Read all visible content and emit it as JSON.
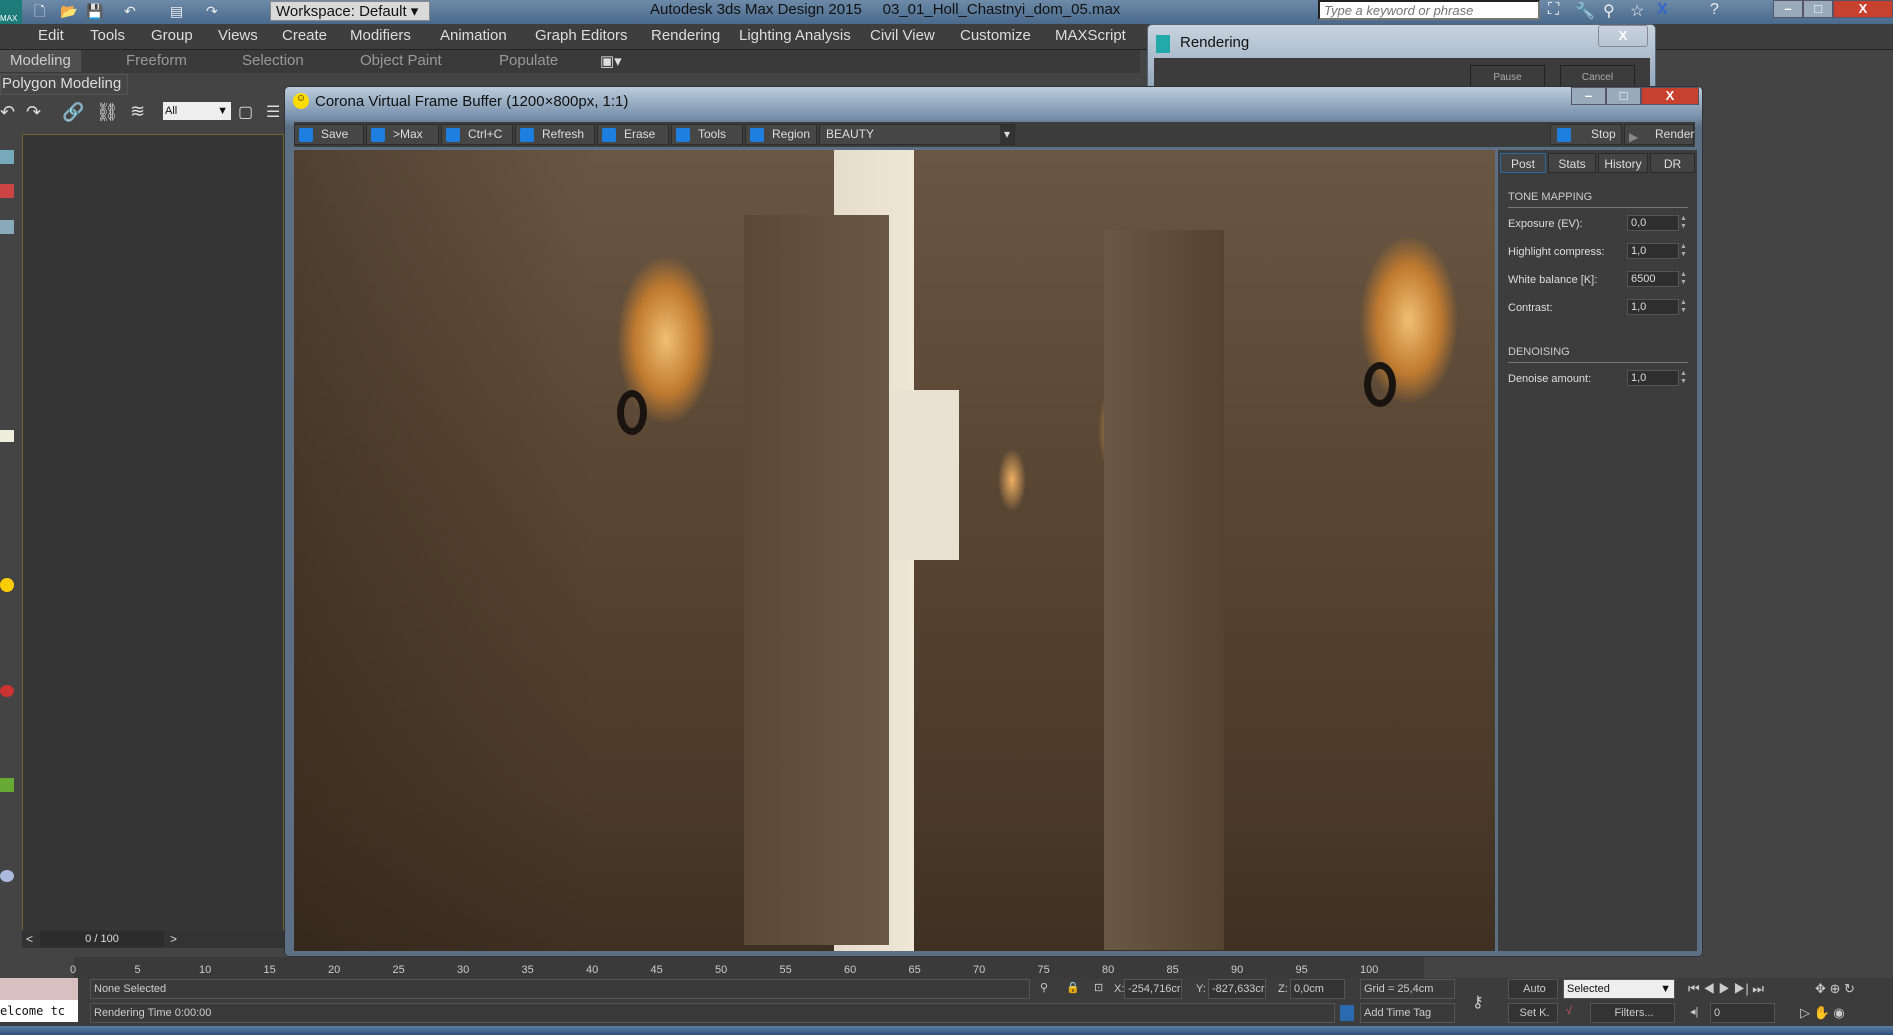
{
  "app": {
    "title": "Autodesk 3ds Max Design 2015",
    "file": "03_01_Holl_Chastnyi_dom_05.max",
    "workspace": "Workspace: Default",
    "search_placeholder": "Type a keyword or phrase",
    "logo": "MAX"
  },
  "menu": [
    "Edit",
    "Tools",
    "Group",
    "Views",
    "Create",
    "Modifiers",
    "Animation",
    "Graph Editors",
    "Rendering",
    "Lighting Analysis",
    "Civil View",
    "Customize",
    "MAXScript"
  ],
  "ribbon": {
    "tabs": [
      "Modeling",
      "Freeform",
      "Selection",
      "Object Paint",
      "Populate"
    ],
    "active": "Modeling",
    "panel": "Polygon Modeling"
  },
  "toolbar": {
    "selection_filter": "All"
  },
  "viewport": {
    "frame": "0 / 100",
    "prev": "<",
    "next": ">"
  },
  "rendering_dialog": {
    "title": "Rendering",
    "pause": "Pause",
    "cancel": "Cancel",
    "close": "X"
  },
  "vfb": {
    "title": "Corona Virtual Frame Buffer (1200×800px, 1:1)",
    "buttons": [
      "Save",
      ">Max",
      "Ctrl+C",
      "Refresh",
      "Erase",
      "Tools",
      "Region"
    ],
    "channel": "BEAUTY",
    "stop": "Stop",
    "render": "Render",
    "tabs": [
      "Post",
      "Stats",
      "History",
      "DR"
    ],
    "active_tab": "Post",
    "tone_mapping": {
      "header": "TONE MAPPING",
      "rows": [
        {
          "label": "Exposure (EV):",
          "value": "0,0"
        },
        {
          "label": "Highlight compress:",
          "value": "1,0"
        },
        {
          "label": "White balance [K]:",
          "value": "6500"
        },
        {
          "label": "Contrast:",
          "value": "1,0"
        }
      ]
    },
    "denoising": {
      "header": "DENOISING",
      "rows": [
        {
          "label": "Denoise amount:",
          "value": "1,0"
        }
      ]
    }
  },
  "timeline": {
    "ticks": [
      "0",
      "5",
      "10",
      "15",
      "20",
      "25",
      "30",
      "35",
      "40",
      "45",
      "50",
      "55",
      "60",
      "65",
      "70",
      "75",
      "80",
      "85",
      "90",
      "95",
      "100"
    ]
  },
  "status": {
    "selection": "None Selected",
    "render_time": "Rendering Time  0:00:00",
    "x_label": "X:",
    "x": "-254,716cr",
    "y_label": "Y:",
    "y": "-827,633cr",
    "z_label": "Z:",
    "z": "0,0cm",
    "grid": "Grid = 25,4cm",
    "add_time_tag": "Add Time Tag",
    "auto": "Auto",
    "set_key": "Set K.",
    "key_filter": "Selected",
    "filters": "Filters...",
    "frame": "0",
    "listener": "elcome tc"
  }
}
